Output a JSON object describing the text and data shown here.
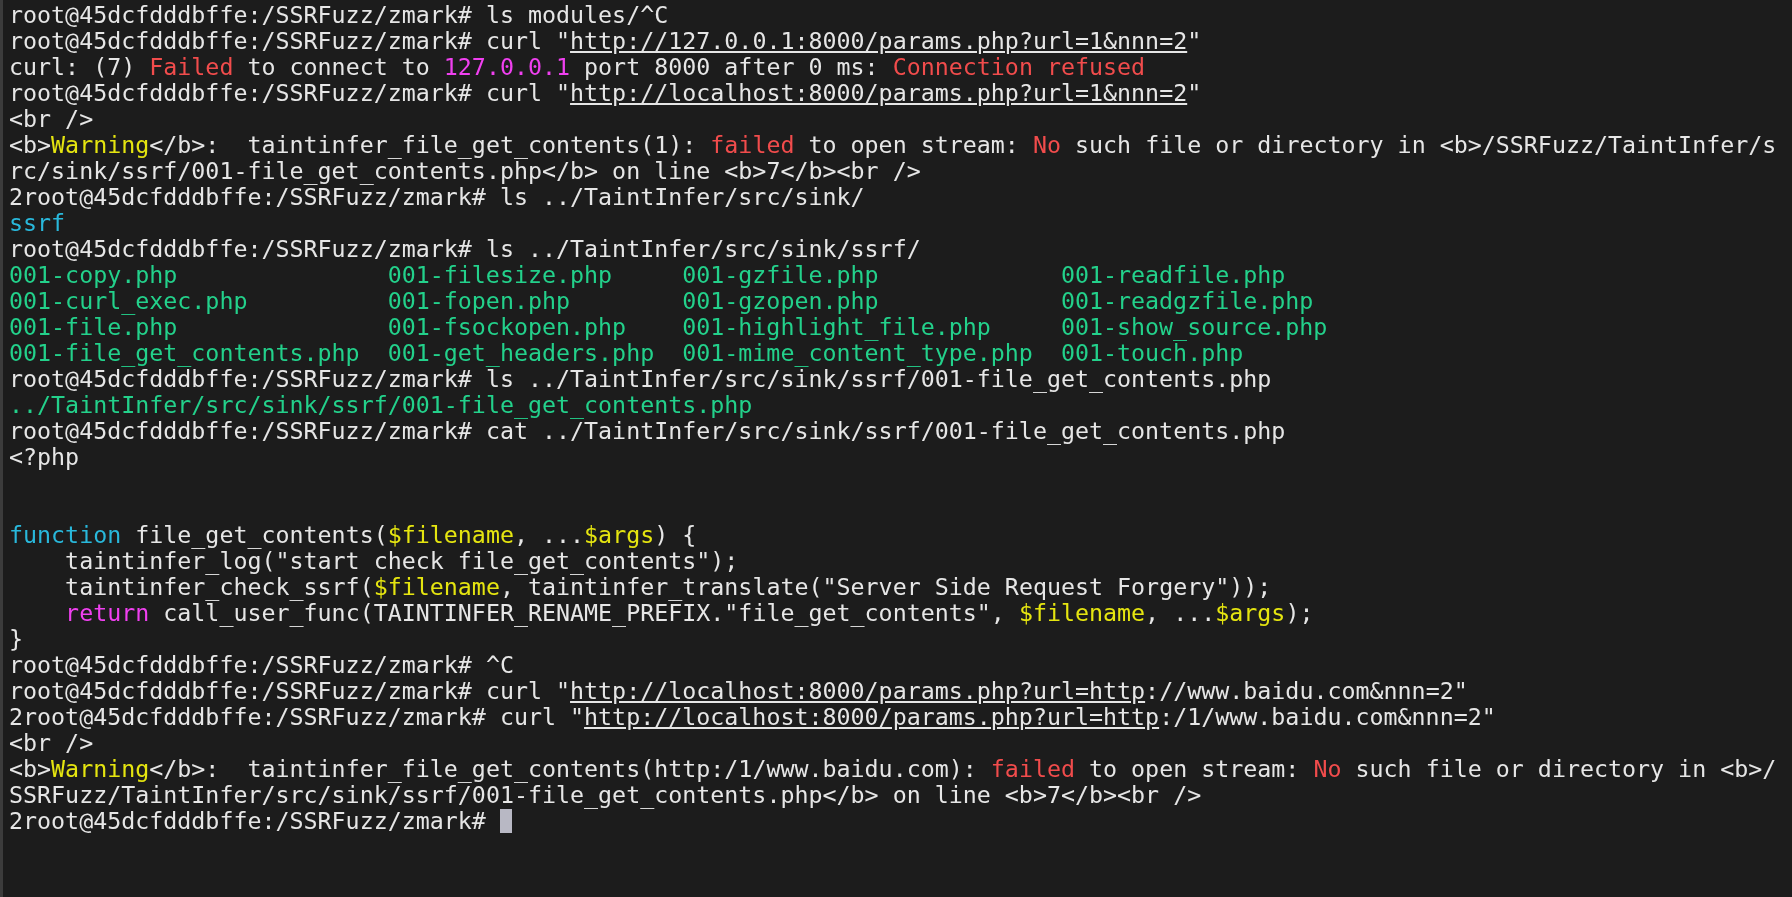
{
  "terminal": {
    "lines": [
      {
        "kind": "text",
        "segments": [
          {
            "text": "root@45dcfdddbffe:/SSRFuzz/zmark# ls modules/^C",
            "kind": "plain"
          }
        ]
      },
      {
        "kind": "text",
        "segments": [
          {
            "text": "root@45dcfdddbffe:/SSRFuzz/zmark# curl \"",
            "kind": "plain"
          },
          {
            "text": "http://127.0.0.1:8000/params.php?url=1&nnn=2",
            "kind": "link"
          },
          {
            "text": "\"",
            "kind": "plain"
          }
        ]
      },
      {
        "kind": "text",
        "segments": [
          {
            "text": "curl: (7) ",
            "kind": "plain"
          },
          {
            "text": "Failed",
            "kind": "red"
          },
          {
            "text": " to connect to ",
            "kind": "plain"
          },
          {
            "text": "127.0.0.1",
            "kind": "magenta"
          },
          {
            "text": " port 8000 after 0 ms: ",
            "kind": "plain"
          },
          {
            "text": "Connection refused",
            "kind": "red"
          }
        ]
      },
      {
        "kind": "text",
        "segments": [
          {
            "text": "root@45dcfdddbffe:/SSRFuzz/zmark# curl \"",
            "kind": "plain"
          },
          {
            "text": "http://localhost:8000/params.php?url=1&nnn=2",
            "kind": "link"
          },
          {
            "text": "\"",
            "kind": "plain"
          }
        ]
      },
      {
        "kind": "text",
        "segments": [
          {
            "text": "<br />",
            "kind": "plain"
          }
        ]
      },
      {
        "kind": "text",
        "segments": [
          {
            "text": "<b>",
            "kind": "plain"
          },
          {
            "text": "Warning",
            "kind": "yellow"
          },
          {
            "text": "</b>:  taintinfer_file_get_contents(1): ",
            "kind": "plain"
          },
          {
            "text": "failed",
            "kind": "red"
          },
          {
            "text": " to open stream: ",
            "kind": "plain"
          },
          {
            "text": "No",
            "kind": "red"
          },
          {
            "text": " such file or directory in <b>/SSRFuzz/TaintInfer/s",
            "kind": "plain"
          }
        ]
      },
      {
        "kind": "text",
        "segments": [
          {
            "text": "rc/sink/ssrf/001-file_get_contents.php</b> on line <b>7</b><br />",
            "kind": "plain"
          }
        ]
      },
      {
        "kind": "text",
        "segments": [
          {
            "text": "2root@45dcfdddbffe:/SSRFuzz/zmark# ls ../TaintInfer/src/sink/",
            "kind": "plain"
          }
        ]
      },
      {
        "kind": "listing",
        "entries": [
          {
            "text": "ssrf",
            "kind": "dir"
          }
        ]
      },
      {
        "kind": "text",
        "segments": [
          {
            "text": "root@45dcfdddbffe:/SSRFuzz/zmark# ls ../TaintInfer/src/sink/ssrf/",
            "kind": "plain"
          }
        ]
      },
      {
        "kind": "listing",
        "entries": [
          {
            "text": "001-copy.php",
            "kind": "file"
          },
          {
            "text": "001-filesize.php",
            "kind": "file"
          },
          {
            "text": "001-gzfile.php",
            "kind": "file"
          },
          {
            "text": "001-readfile.php",
            "kind": "file"
          }
        ]
      },
      {
        "kind": "listing",
        "entries": [
          {
            "text": "001-curl_exec.php",
            "kind": "file"
          },
          {
            "text": "001-fopen.php",
            "kind": "file"
          },
          {
            "text": "001-gzopen.php",
            "kind": "file"
          },
          {
            "text": "001-readgzfile.php",
            "kind": "file"
          }
        ]
      },
      {
        "kind": "listing",
        "entries": [
          {
            "text": "001-file.php",
            "kind": "file"
          },
          {
            "text": "001-fsockopen.php",
            "kind": "file"
          },
          {
            "text": "001-highlight_file.php",
            "kind": "file"
          },
          {
            "text": "001-show_source.php",
            "kind": "file"
          }
        ]
      },
      {
        "kind": "listing",
        "entries": [
          {
            "text": "001-file_get_contents.php",
            "kind": "file"
          },
          {
            "text": "001-get_headers.php",
            "kind": "file"
          },
          {
            "text": "001-mime_content_type.php",
            "kind": "file"
          },
          {
            "text": "001-touch.php",
            "kind": "file"
          }
        ]
      },
      {
        "kind": "text",
        "segments": [
          {
            "text": "root@45dcfdddbffe:/SSRFuzz/zmark# ls ../TaintInfer/src/sink/ssrf/001-file_get_contents.php",
            "kind": "plain"
          }
        ]
      },
      {
        "kind": "listing",
        "entries": [
          {
            "text": "../TaintInfer/src/sink/ssrf/001-file_get_contents.php",
            "kind": "file"
          }
        ]
      },
      {
        "kind": "text",
        "segments": [
          {
            "text": "root@45dcfdddbffe:/SSRFuzz/zmark# cat ../TaintInfer/src/sink/ssrf/001-file_get_contents.php",
            "kind": "plain"
          }
        ]
      },
      {
        "kind": "text",
        "segments": [
          {
            "text": "<?php",
            "kind": "plain"
          }
        ]
      },
      {
        "kind": "blank"
      },
      {
        "kind": "blank"
      },
      {
        "kind": "text",
        "segments": [
          {
            "text": "function",
            "kind": "cyan"
          },
          {
            "text": " file_get_contents(",
            "kind": "plain"
          },
          {
            "text": "$filename",
            "kind": "yellow"
          },
          {
            "text": ", ...",
            "kind": "plain"
          },
          {
            "text": "$args",
            "kind": "yellow"
          },
          {
            "text": ") {",
            "kind": "plain"
          }
        ]
      },
      {
        "kind": "text",
        "segments": [
          {
            "text": "    taintinfer_log(\"start check file_get_contents\");",
            "kind": "plain"
          }
        ]
      },
      {
        "kind": "text",
        "segments": [
          {
            "text": "    taintinfer_check_ssrf(",
            "kind": "plain"
          },
          {
            "text": "$filename",
            "kind": "yellow"
          },
          {
            "text": ", taintinfer_translate(\"Server Side Request Forgery\"));",
            "kind": "plain"
          }
        ]
      },
      {
        "kind": "text",
        "segments": [
          {
            "text": "    return",
            "kind": "magenta"
          },
          {
            "text": " call_user_func(TAINTINFER_RENAME_PREFIX.\"file_get_contents\", ",
            "kind": "plain"
          },
          {
            "text": "$filename",
            "kind": "yellow"
          },
          {
            "text": ", ...",
            "kind": "plain"
          },
          {
            "text": "$args",
            "kind": "yellow"
          },
          {
            "text": ");",
            "kind": "plain"
          }
        ]
      },
      {
        "kind": "text",
        "segments": [
          {
            "text": "}",
            "kind": "plain"
          }
        ]
      },
      {
        "kind": "text",
        "segments": [
          {
            "text": "root@45dcfdddbffe:/SSRFuzz/zmark# ^C",
            "kind": "plain"
          }
        ]
      },
      {
        "kind": "text",
        "segments": [
          {
            "text": "root@45dcfdddbffe:/SSRFuzz/zmark# curl \"",
            "kind": "plain"
          },
          {
            "text": "http://localhost:8000/params.php?url=http",
            "kind": "link"
          },
          {
            "text": "://www.baidu.com&nnn=2\"",
            "kind": "plain"
          }
        ]
      },
      {
        "kind": "text",
        "segments": [
          {
            "text": "2root@45dcfdddbffe:/SSRFuzz/zmark# curl \"",
            "kind": "plain"
          },
          {
            "text": "http://localhost:8000/params.php?url=http",
            "kind": "link"
          },
          {
            "text": ":/1/www.baidu.com&nnn=2\"",
            "kind": "plain"
          }
        ]
      },
      {
        "kind": "text",
        "segments": [
          {
            "text": "<br />",
            "kind": "plain"
          }
        ]
      },
      {
        "kind": "text",
        "segments": [
          {
            "text": "<b>",
            "kind": "plain"
          },
          {
            "text": "Warning",
            "kind": "yellow"
          },
          {
            "text": "</b>:  taintinfer_file_get_contents(http:/1/www.baidu.com): ",
            "kind": "plain"
          },
          {
            "text": "failed",
            "kind": "red"
          },
          {
            "text": " to open stream: ",
            "kind": "plain"
          },
          {
            "text": "No",
            "kind": "red"
          },
          {
            "text": " such file or directory in <b>/",
            "kind": "plain"
          }
        ]
      },
      {
        "kind": "text",
        "segments": [
          {
            "text": "SSRFuzz/TaintInfer/src/sink/ssrf/001-file_get_contents.php</b> on line <b>7</b><br />",
            "kind": "plain"
          }
        ]
      },
      {
        "kind": "text",
        "segments": [
          {
            "text": "2root@45dcfdddbffe:/SSRFuzz/zmark# ",
            "kind": "plain"
          }
        ]
      }
    ],
    "cursor": {
      "visible": true
    }
  }
}
